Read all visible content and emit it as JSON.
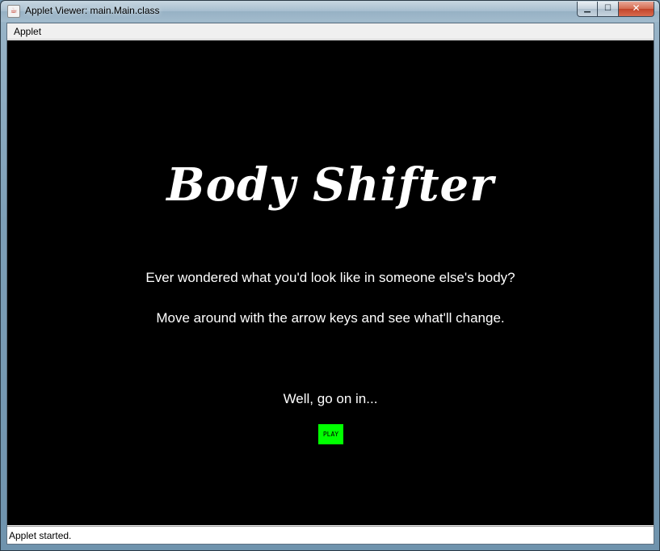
{
  "window": {
    "title": "Applet Viewer: main.Main.class",
    "icon": "java-cup-icon",
    "controls": {
      "minimize": "▁",
      "maximize": "☐",
      "close": "✕"
    }
  },
  "menubar": {
    "items": [
      {
        "label": "Applet"
      }
    ]
  },
  "applet": {
    "background_color": "#000000",
    "text_color": "#ffffff",
    "title": "Body Shifter",
    "lines": [
      "Ever wondered what you'd look like in someone else's body?",
      "Move around with the arrow keys and see what'll change.",
      "Well, go on in..."
    ],
    "play_button": {
      "label": "PLAY",
      "color": "#00ff00"
    }
  },
  "statusbar": {
    "text": "Applet started."
  }
}
